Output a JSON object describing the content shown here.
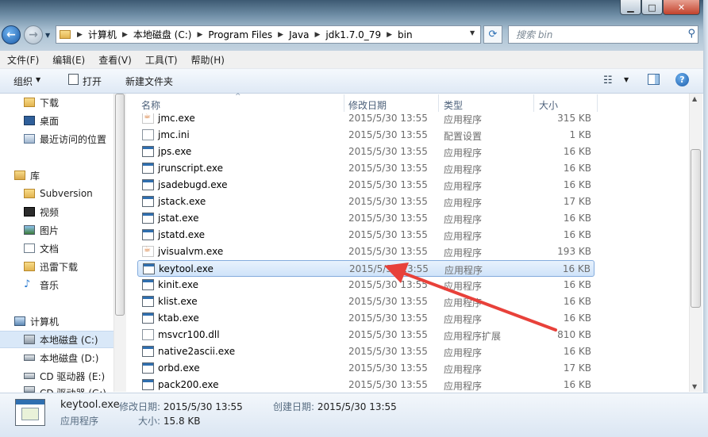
{
  "window": {
    "minimize_glyph": "▁",
    "maximize_glyph": "□",
    "close_glyph": "✕"
  },
  "address": {
    "crumbs": [
      "计算机",
      "本地磁盘 (C:)",
      "Program Files",
      "Java",
      "jdk1.7.0_79",
      "bin"
    ],
    "search_placeholder": "搜索 bin"
  },
  "menu": [
    "文件(F)",
    "编辑(E)",
    "查看(V)",
    "工具(T)",
    "帮助(H)"
  ],
  "toolbar": {
    "organize": "组织",
    "open": "打开",
    "new_folder": "新建文件夹"
  },
  "nav": {
    "favorites": [
      {
        "label": "下载",
        "icon": "download-folder-icon"
      },
      {
        "label": "桌面",
        "icon": "desktop-icon"
      },
      {
        "label": "最近访问的位置",
        "icon": "recent-places-icon"
      }
    ],
    "library_label": "库",
    "libraries": [
      {
        "label": "Subversion",
        "icon": "library-folder-icon"
      },
      {
        "label": "视频",
        "icon": "video-library-icon"
      },
      {
        "label": "图片",
        "icon": "pictures-library-icon"
      },
      {
        "label": "文档",
        "icon": "documents-library-icon"
      },
      {
        "label": "迅雷下载",
        "icon": "thunder-download-icon"
      },
      {
        "label": "音乐",
        "icon": "music-library-icon"
      }
    ],
    "computer_label": "计算机",
    "drives": [
      {
        "label": "本地磁盘 (C:)",
        "icon": "system-drive-icon",
        "selected": true
      },
      {
        "label": "本地磁盘 (D:)",
        "icon": "drive-icon"
      },
      {
        "label": "CD 驱动器 (E:)",
        "icon": "cd-drive-icon"
      },
      {
        "label": "CD 驱动器 (G:)",
        "icon": "cd-drive-icon"
      }
    ]
  },
  "columns": {
    "name": "名称",
    "date": "修改日期",
    "type": "类型",
    "size": "大小"
  },
  "files": [
    {
      "name": "jmc.exe",
      "date": "2015/5/30 13:55",
      "type": "应用程序",
      "size": "315 KB",
      "icon": "java-app-icon"
    },
    {
      "name": "jmc.ini",
      "date": "2015/5/30 13:55",
      "type": "配置设置",
      "size": "1 KB",
      "icon": "config-file-icon"
    },
    {
      "name": "jps.exe",
      "date": "2015/5/30 13:55",
      "type": "应用程序",
      "size": "16 KB",
      "icon": "exe-icon"
    },
    {
      "name": "jrunscript.exe",
      "date": "2015/5/30 13:55",
      "type": "应用程序",
      "size": "16 KB",
      "icon": "exe-icon"
    },
    {
      "name": "jsadebugd.exe",
      "date": "2015/5/30 13:55",
      "type": "应用程序",
      "size": "16 KB",
      "icon": "exe-icon"
    },
    {
      "name": "jstack.exe",
      "date": "2015/5/30 13:55",
      "type": "应用程序",
      "size": "17 KB",
      "icon": "exe-icon"
    },
    {
      "name": "jstat.exe",
      "date": "2015/5/30 13:55",
      "type": "应用程序",
      "size": "16 KB",
      "icon": "exe-icon"
    },
    {
      "name": "jstatd.exe",
      "date": "2015/5/30 13:55",
      "type": "应用程序",
      "size": "16 KB",
      "icon": "exe-icon"
    },
    {
      "name": "jvisualvm.exe",
      "date": "2015/5/30 13:55",
      "type": "应用程序",
      "size": "193 KB",
      "icon": "java-app-icon"
    },
    {
      "name": "keytool.exe",
      "date": "2015/5/30 13:55",
      "type": "应用程序",
      "size": "16 KB",
      "icon": "exe-icon",
      "selected": true
    },
    {
      "name": "kinit.exe",
      "date": "2015/5/30 13:55",
      "type": "应用程序",
      "size": "16 KB",
      "icon": "exe-icon"
    },
    {
      "name": "klist.exe",
      "date": "2015/5/30 13:55",
      "type": "应用程序",
      "size": "16 KB",
      "icon": "exe-icon"
    },
    {
      "name": "ktab.exe",
      "date": "2015/5/30 13:55",
      "type": "应用程序",
      "size": "16 KB",
      "icon": "exe-icon"
    },
    {
      "name": "msvcr100.dll",
      "date": "2015/5/30 13:55",
      "type": "应用程序扩展",
      "size": "810 KB",
      "icon": "dll-icon"
    },
    {
      "name": "native2ascii.exe",
      "date": "2015/5/30 13:55",
      "type": "应用程序",
      "size": "16 KB",
      "icon": "exe-icon"
    },
    {
      "name": "orbd.exe",
      "date": "2015/5/30 13:55",
      "type": "应用程序",
      "size": "17 KB",
      "icon": "exe-icon"
    },
    {
      "name": "pack200.exe",
      "date": "2015/5/30 13:55",
      "type": "应用程序",
      "size": "16 KB",
      "icon": "exe-icon"
    }
  ],
  "details": {
    "name": "keytool.exe",
    "type": "应用程序",
    "modified_label": "修改日期:",
    "modified": "2015/5/30 13:55",
    "created_label": "创建日期:",
    "created": "2015/5/30 13:55",
    "size_label": "大小:",
    "size": "15.8 KB"
  },
  "colors": {
    "selection_bg": "#cfe3f9",
    "selection_border": "#84acdd",
    "annotation_arrow": "#e8413a"
  }
}
